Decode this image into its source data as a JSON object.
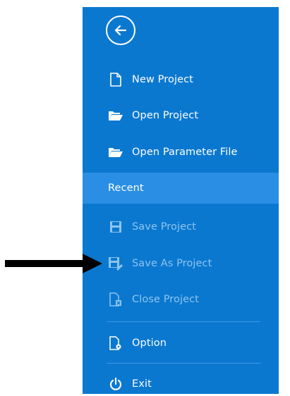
{
  "menu": {
    "items": [
      {
        "label": "New Project",
        "icon": "new-document-icon",
        "enabled": true
      },
      {
        "label": "Open Project",
        "icon": "open-folder-icon",
        "enabled": true
      },
      {
        "label": "Open Parameter File",
        "icon": "open-folder-icon",
        "enabled": true
      },
      {
        "label": "Recent",
        "icon": "",
        "enabled": true,
        "selected": true
      },
      {
        "label": "Save Project",
        "icon": "save-icon",
        "enabled": false
      },
      {
        "label": "Save As Project",
        "icon": "save-as-icon",
        "enabled": false
      },
      {
        "label": "Close Project",
        "icon": "close-document-icon",
        "enabled": false
      },
      {
        "label": "Option",
        "icon": "option-document-icon",
        "enabled": true
      },
      {
        "label": "Exit",
        "icon": "power-icon",
        "enabled": true
      }
    ]
  },
  "colors": {
    "panel": "#0b78d0",
    "selected": "#2a8fe4",
    "disabled_text": "#8ec4ee",
    "annotation_arrow": "#000000"
  }
}
